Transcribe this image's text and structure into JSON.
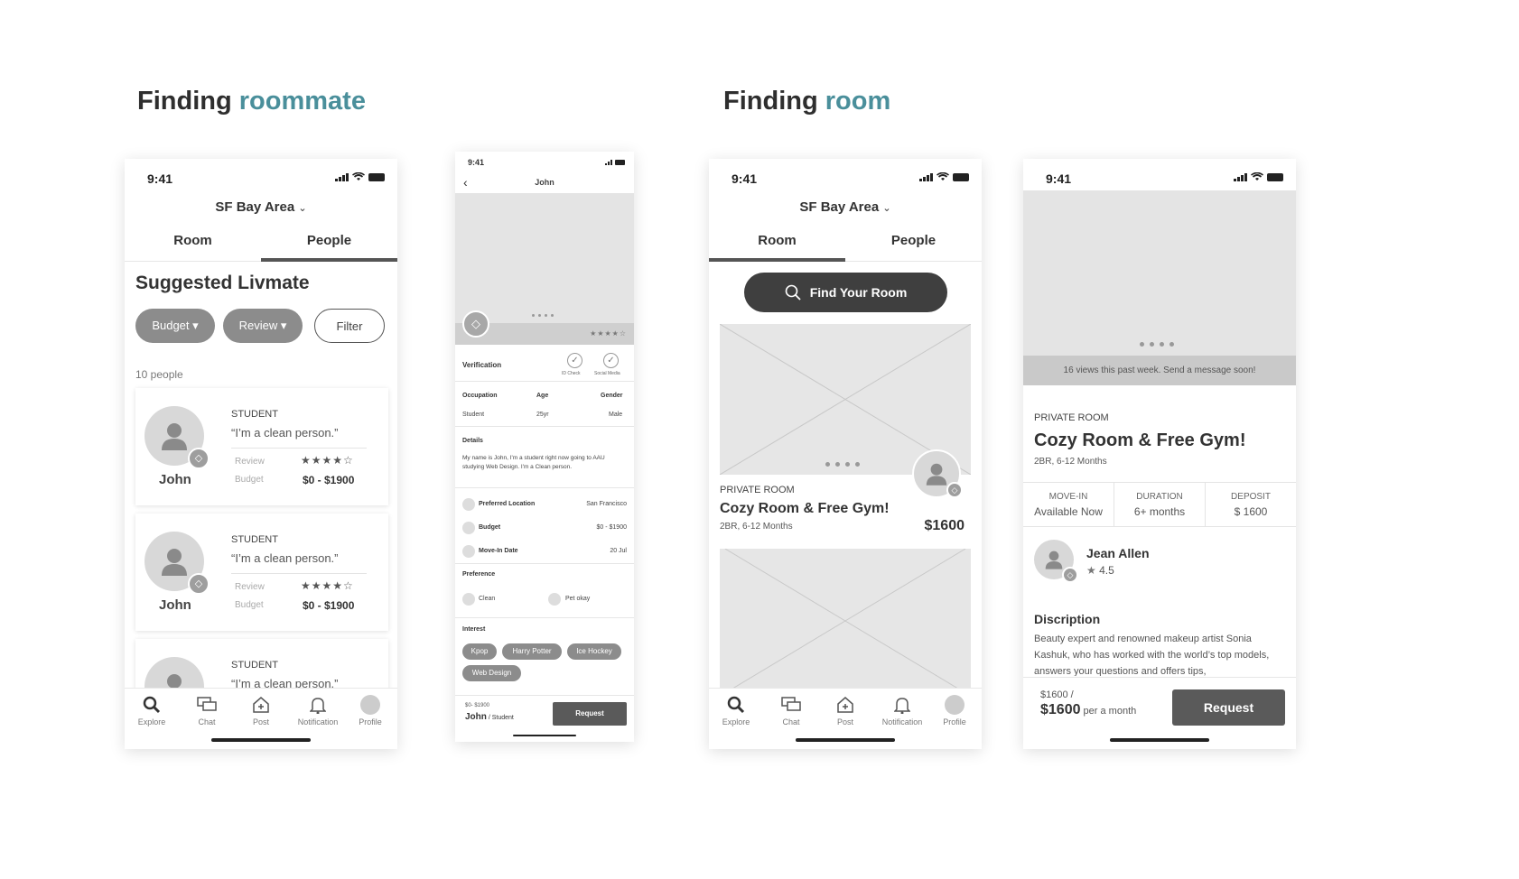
{
  "sections": {
    "roommate": {
      "title_a": "Finding ",
      "title_b": "roommate"
    },
    "room": {
      "title_a": "Finding ",
      "title_b": "room"
    }
  },
  "status": {
    "time": "9:41"
  },
  "p1": {
    "location": "SF Bay Area",
    "tabs": [
      "Room",
      "People"
    ],
    "heading": "Suggested Livmate",
    "filters": {
      "budget": "Budget",
      "review": "Review",
      "filter": "Filter"
    },
    "count": "10 people",
    "cards": [
      {
        "role": "STUDENT",
        "quote": "“I’m a clean person.”",
        "review_label": "Review",
        "budget_label": "Budget",
        "budget": "$0 - $1900",
        "name": "John"
      },
      {
        "role": "STUDENT",
        "quote": "“I’m a clean person.”",
        "review_label": "Review",
        "budget_label": "Budget",
        "budget": "$0 - $1900",
        "name": "John"
      },
      {
        "role": "STUDENT",
        "quote": "“I’m a clean person.”"
      }
    ],
    "rating": 4
  },
  "nav": {
    "explore": "Explore",
    "chat": "Chat",
    "post": "Post",
    "notification": "Notification",
    "profile": "Profile"
  },
  "p2": {
    "time": "9:41",
    "title": "John",
    "verification": "Verification",
    "id_check": "ID Check",
    "social_media": "Social Media",
    "occupation_label": "Occupation",
    "age_label": "Age",
    "gender_label": "Gender",
    "occupation": "Student",
    "age": "25yr",
    "gender": "Male",
    "details_label": "Details",
    "details": "My name is John, I'm a student right now going to AAU studying Web Design. I'm a Clean person.",
    "pref_location_label": "Preferred Location",
    "pref_location": "San Francisco",
    "budget_label": "Budget",
    "budget": "$0 - $1900",
    "move_in_label": "Move-In Date",
    "move_in": "20 Jul",
    "preference_label": "Preference",
    "pref_clean": "Clean",
    "pref_pet": "Pet okay",
    "interest_label": "Interest",
    "interests": [
      "Kpop",
      "Harry Potter",
      "Ice Hockey",
      "Web Design"
    ],
    "footer_budget": "$0- $1900",
    "footer_name": "John",
    "footer_role": " / Student",
    "request": "Request"
  },
  "p3": {
    "location": "SF Bay Area",
    "tabs": [
      "Room",
      "People"
    ],
    "search": "Find Your Room",
    "listing": {
      "type": "PRIVATE ROOM",
      "title": "Cozy Room & Free Gym!",
      "meta": "2BR, 6-12 Months",
      "price": "$1600"
    }
  },
  "p4": {
    "views": "16 views this past week. Send a message soon!",
    "type": "PRIVATE ROOM",
    "title": "Cozy Room & Free Gym!",
    "meta": "2BR, 6-12 Months",
    "stats": [
      {
        "label": "MOVE-IN",
        "value": "Available Now"
      },
      {
        "label": "DURATION",
        "value": "6+ months"
      },
      {
        "label": "DEPOSIT",
        "value": "$ 1600"
      }
    ],
    "host": "Jean Allen",
    "host_rating": "4.5",
    "desc_label": "Discription",
    "desc": "Beauty expert and renowned makeup artist Sonia Kashuk, who has worked with the world’s top models, answers your questions and offers tips,",
    "price_small": "$1600 /",
    "price": "$1600",
    "per": " per a month",
    "request": "Request"
  }
}
